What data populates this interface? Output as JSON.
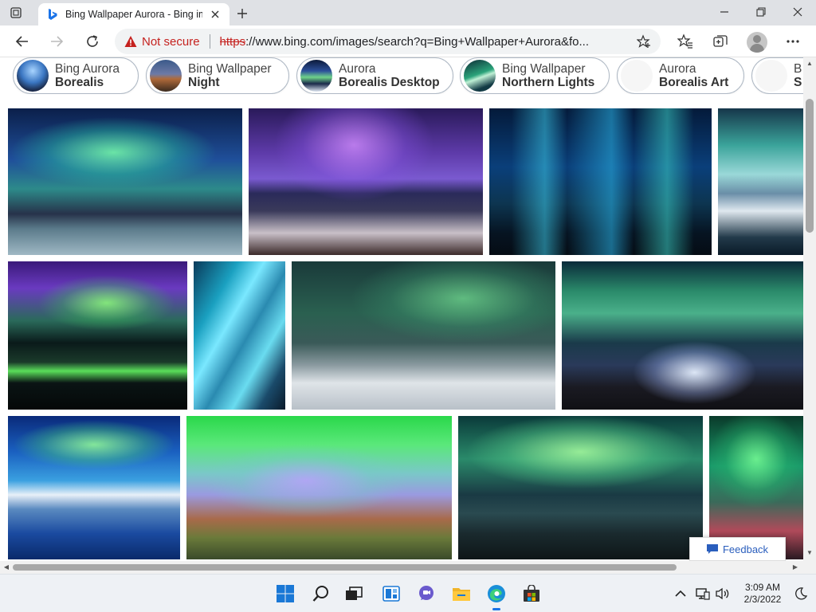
{
  "browser": {
    "tab_title": "Bing Wallpaper Aurora - Bing im",
    "address": {
      "security_label": "Not secure",
      "scheme": "https",
      "rest": "://www.bing.com/images/search?q=Bing+Wallpaper+Aurora&fo..."
    }
  },
  "page": {
    "chips": [
      {
        "line1": "Bing Aurora",
        "line2": "Borealis"
      },
      {
        "line1": "Bing Wallpaper",
        "line2": "Night"
      },
      {
        "line1": "Aurora",
        "line2": "Borealis Desktop"
      },
      {
        "line1": "Bing Wallpaper",
        "line2": "Northern Lights"
      },
      {
        "line1": "Aurora",
        "line2": "Borealis Art"
      },
      {
        "line1": "B",
        "line2": "S"
      }
    ],
    "feedback_label": "Feedback"
  },
  "taskbar": {
    "time": "3:09 AM",
    "date": "2/3/2022"
  },
  "colors": {
    "accent_blue": "#1a73e8",
    "warning_red": "#c5221f",
    "chip_border": "#aeb8c4"
  }
}
